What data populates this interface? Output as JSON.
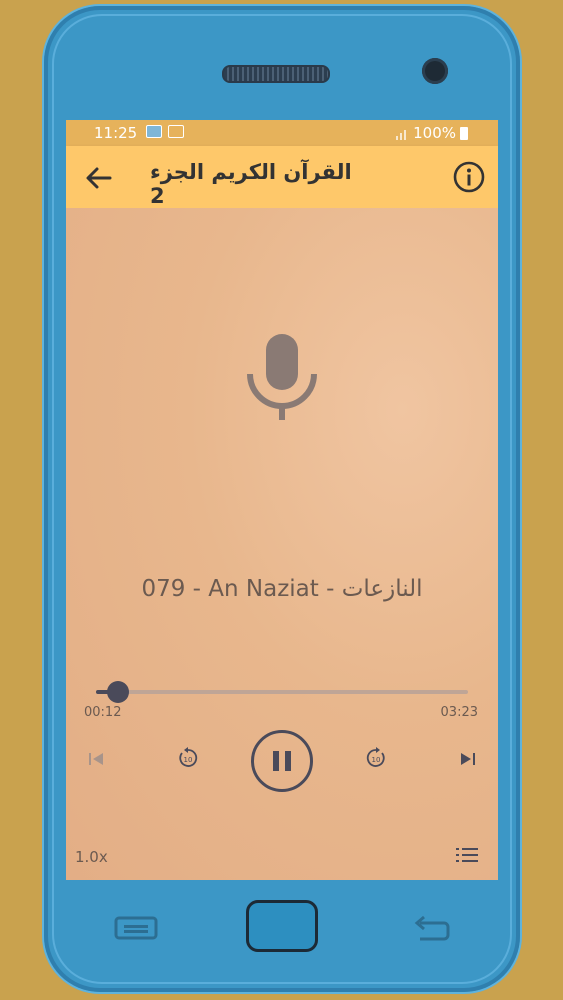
{
  "status_bar": {
    "time": "11:25",
    "battery": "100%"
  },
  "app_bar": {
    "title": "القرآن الكريم الجزء 2",
    "back_icon": "arrow-left-icon",
    "info_icon": "info-circle-icon"
  },
  "player": {
    "artwork_icon": "microphone-icon",
    "track_title": "079 - An Naziat - النازعات",
    "current_time": "00:12",
    "total_time": "03:23",
    "progress_fraction": 0.059,
    "controls": {
      "previous_icon": "skip-previous-icon",
      "rewind_icon": "rewind-10-icon",
      "play_pause_icon": "pause-icon",
      "forward_icon": "forward-10-icon",
      "next_icon": "skip-next-icon",
      "rewind_seconds": "10",
      "forward_seconds": "10"
    },
    "speed": "1.0x",
    "playlist_icon": "playlist-icon"
  },
  "colors": {
    "app_bar": "#fec86a",
    "status_bar": "#e6b25b",
    "content_bg": "#e9b68c",
    "control_dark": "#4a4a5a",
    "phone_body": "#3c97c6",
    "page_bg": "#c9a24e"
  }
}
